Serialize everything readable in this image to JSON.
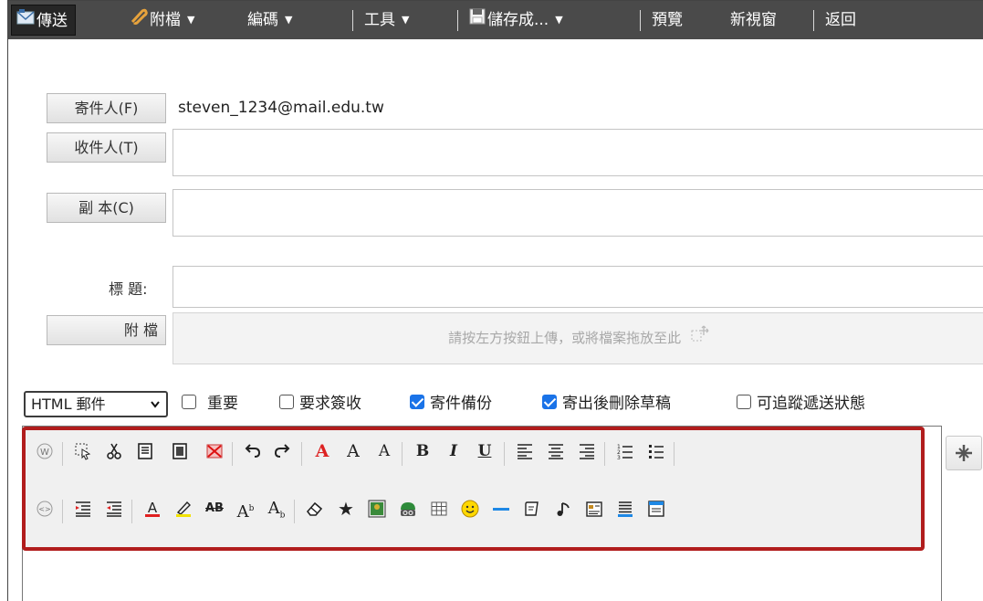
{
  "toolbar": {
    "send": "傳送",
    "attach": "附檔",
    "encoding": "編碼",
    "tools": "工具",
    "save_as": "儲存成...",
    "preview": "預覽",
    "new_window": "新視窗",
    "back": "返回",
    "dropdown_arrow": "▼"
  },
  "form": {
    "from_button": "寄件人(F)",
    "from_value": "steven_1234@mail.edu.tw",
    "to_button": "收件人(T)",
    "to_value": "",
    "cc_button": "副 本(C)",
    "cc_value": "",
    "subject_label": "標 題:",
    "subject_value": "",
    "attachment_label": "附 檔",
    "dropzone_text": "請按左方按鈕上傳，或將檔案拖放至此"
  },
  "options": {
    "format_selected": "HTML 郵件",
    "important": {
      "label": "重要",
      "checked": false
    },
    "read_receipt": {
      "label": "要求簽收",
      "checked": false
    },
    "save_copy": {
      "label": "寄件備份",
      "checked": true
    },
    "delete_draft": {
      "label": "寄出後刪除草稿",
      "checked": true
    },
    "tracking": {
      "label": "可追蹤遞送狀態",
      "checked": false
    }
  },
  "editor": {
    "content": "",
    "row1_icons": [
      "word-paste-icon",
      "select-all-icon",
      "cut-icon",
      "copy-icon",
      "paste-icon",
      "delete-icon",
      "undo-icon",
      "redo-icon",
      "font-face-icon",
      "font-size-icon",
      "font-style-icon",
      "bold-icon",
      "italic-icon",
      "underline-icon",
      "align-left-icon",
      "align-center-icon",
      "align-right-icon",
      "numbered-list-icon",
      "bullet-list-icon"
    ],
    "row2_icons": [
      "source-view-icon",
      "outdent-icon",
      "indent-icon",
      "font-color-icon",
      "highlight-icon",
      "strikethrough-icon",
      "superscript-icon",
      "subscript-icon",
      "remove-format-icon",
      "special-char-icon",
      "insert-image-icon",
      "insert-link-icon",
      "insert-table-icon",
      "emoticon-icon",
      "horizontal-rule-icon",
      "insert-form-icon",
      "insert-media-icon",
      "insert-template-icon",
      "page-break-icon",
      "properties-icon"
    ]
  },
  "colors": {
    "toolbar_bg": "#4a4a4a",
    "highlight_border": "#b11d1d",
    "checkbox_on": "#1a73e8"
  }
}
